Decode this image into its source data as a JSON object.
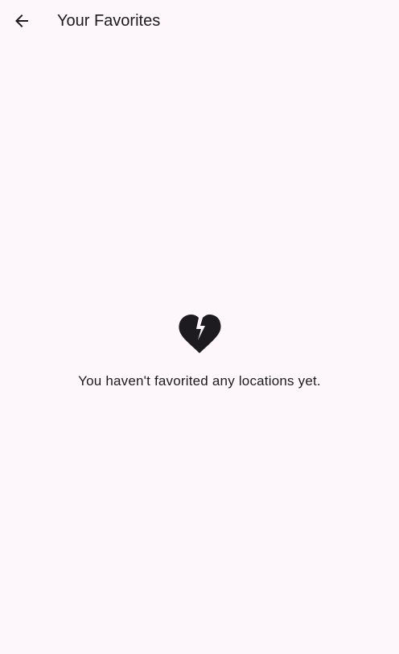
{
  "app_bar": {
    "back_icon": "arrow-back-icon",
    "title": "Your Favorites"
  },
  "empty_state": {
    "icon": "heart-broken-icon",
    "message": "You haven't favorited any locations yet."
  },
  "colors": {
    "background": "#fdf7fc",
    "text": "#1d1b20",
    "icon": "#1d1b20"
  }
}
